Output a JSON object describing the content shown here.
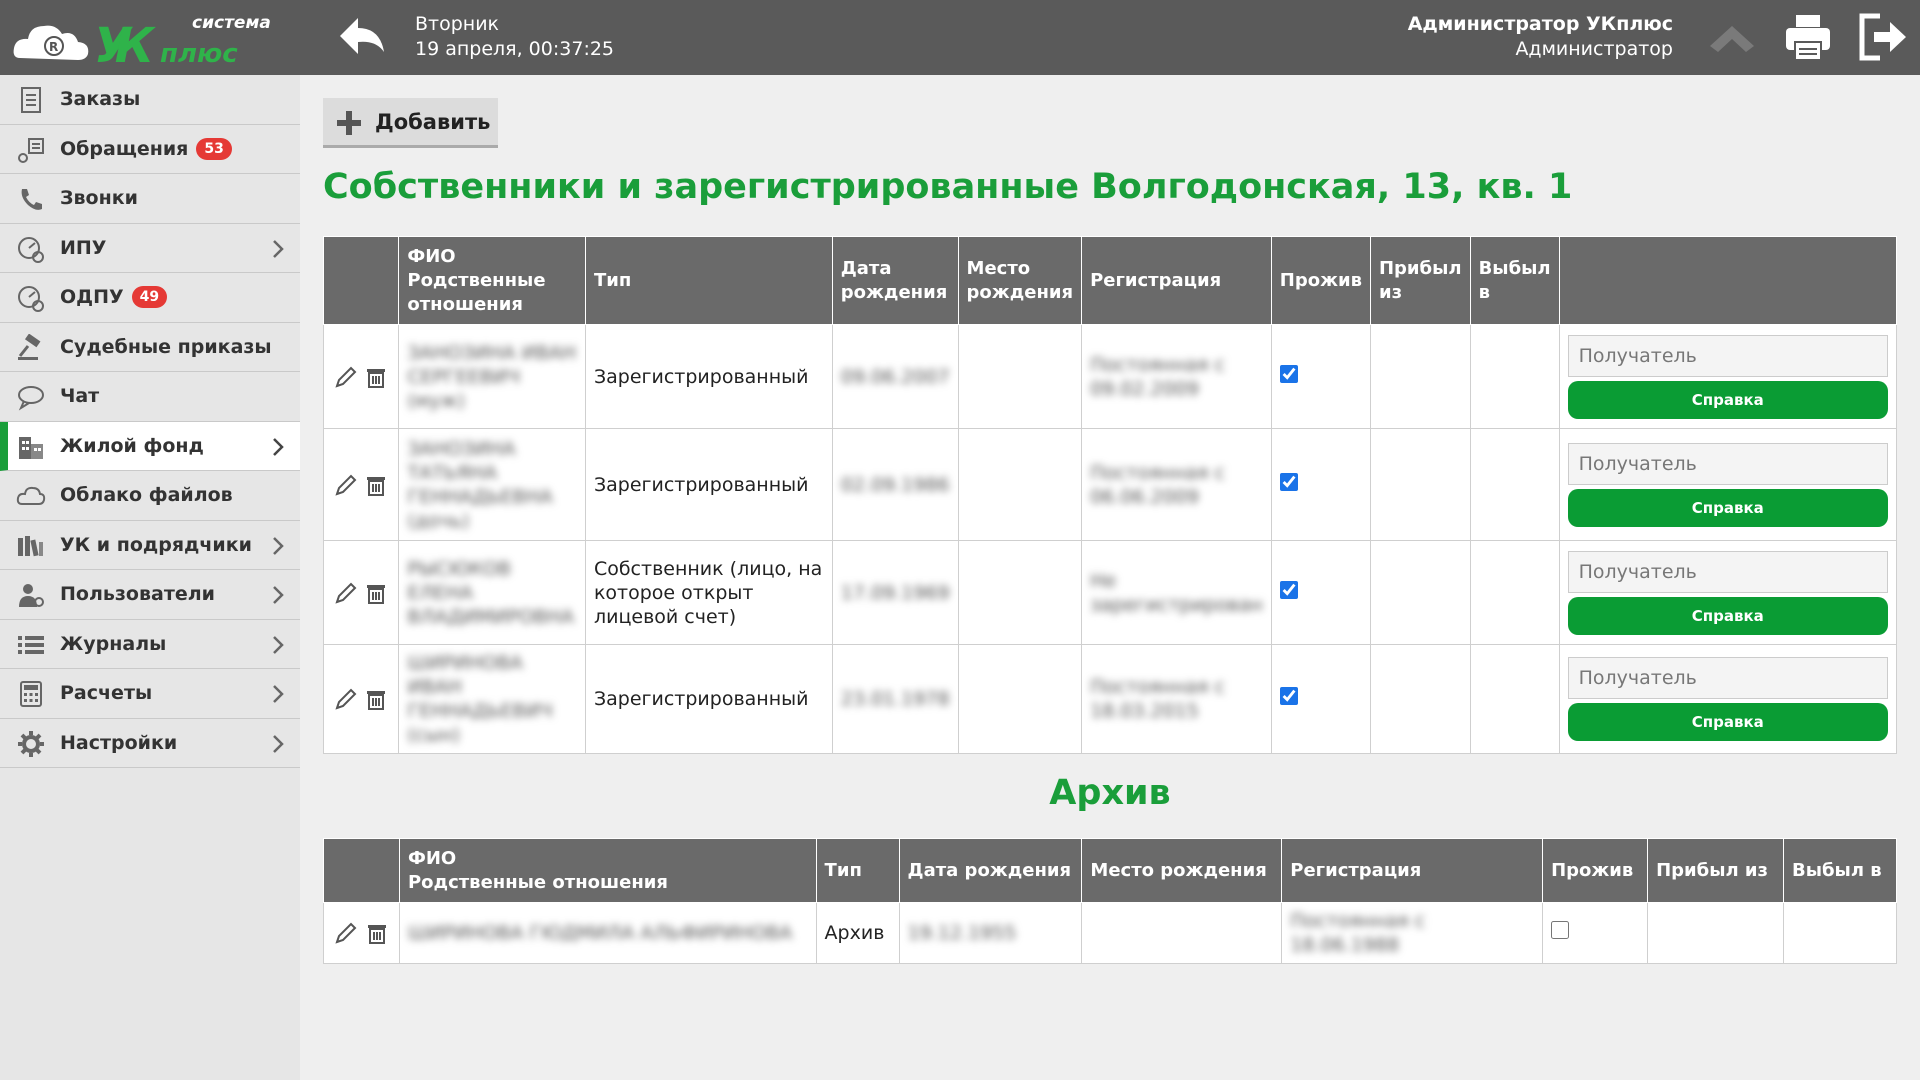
{
  "header": {
    "logo_small": "система",
    "logo_big": "УКплюс",
    "day": "Вторник",
    "datetime": "19 апреля, 00:37:25",
    "user_name": "Администратор УКплюс",
    "user_role": "Администратор"
  },
  "sidebar": {
    "items": [
      {
        "label": "Заказы",
        "icon": "orders-icon"
      },
      {
        "label": "Обращения",
        "badge": "53",
        "icon": "appeals-icon"
      },
      {
        "label": "Звонки",
        "icon": "phone-icon"
      },
      {
        "label": "ИПУ",
        "icon": "meter-icon"
      },
      {
        "label": "ОДПУ",
        "badge": "49",
        "icon": "meter-icon"
      },
      {
        "label": "Судебные приказы",
        "icon": "gavel-icon"
      },
      {
        "label": "Чат",
        "icon": "chat-icon"
      },
      {
        "label": "Жилой фонд",
        "icon": "building-icon"
      },
      {
        "label": "Облако файлов",
        "icon": "cloud-icon"
      },
      {
        "label": "УК и подрядчики",
        "icon": "books-icon"
      },
      {
        "label": "Пользователи",
        "icon": "users-icon"
      },
      {
        "label": "Журналы",
        "icon": "list-icon"
      },
      {
        "label": "Расчеты",
        "icon": "calculator-icon"
      },
      {
        "label": "Настройки",
        "icon": "gear-icon"
      }
    ]
  },
  "main": {
    "add_label": "Добавить",
    "title": "Собственники и зарегистрированные Волгодонская, 13, кв. 1",
    "residents_table": {
      "headers": {
        "fio": "ФИО",
        "relation": "Родственные отношения",
        "type": "Тип",
        "birth_date": "Дата рождения",
        "birth_place": "Место рождения",
        "registration": "Регистрация",
        "lives": "Прожив",
        "arrived": "Прибыл из",
        "left": "Выбыл в"
      },
      "rows": [
        {
          "fio": "ЗАНОЗИНА ИВАН СЕРГЕЕВИЧ (муж)",
          "type": "Зарегистрированный",
          "birth": "09.06.2007",
          "reg": "Постоянная с 09.02.2009",
          "lives": true
        },
        {
          "fio": "ЗАНОЗИНА ТАТЬЯНА ГЕННАДЬЕВНА (дочь)",
          "type": "Зарегистрированный",
          "birth": "02.09.1986",
          "reg": "Постоянная с 06.06.2009",
          "lives": true
        },
        {
          "fio": "РЫСЮКОВ ЕЛЕНА ВЛАДИМИРОВНА",
          "type": "Собственник (лицо, на которое открыт лицевой счет)",
          "birth": "17.09.1969",
          "reg": "Не зарегистрирован",
          "lives": true
        },
        {
          "fio": "ШИРИНОВА ИВАН ГЕННАДЬЕВИЧ (сын)",
          "type": "Зарегистрированный",
          "birth": "23.01.1978",
          "reg": "Постоянная с 18.03.2015",
          "lives": true
        }
      ],
      "recipient_placeholder": "Получатель",
      "certificate_label": "Справка"
    },
    "archive_title": "Архив",
    "archive_table": {
      "headers": {
        "fio": "ФИО",
        "relation": "Родственные отношения",
        "type": "Тип",
        "birth_date": "Дата рождения",
        "birth_place": "Место рождения",
        "registration": "Регистрация",
        "lives": "Прожив",
        "arrived": "Прибыл из",
        "left": "Выбыл в"
      },
      "rows": [
        {
          "fio": "ШИРИНОВА ГЮДМИЛА АЛЬФИРИНОВА",
          "type": "Архив",
          "birth": "19.12.1955",
          "reg": "Постоянная с 18.06.1988",
          "lives": false
        }
      ]
    }
  }
}
